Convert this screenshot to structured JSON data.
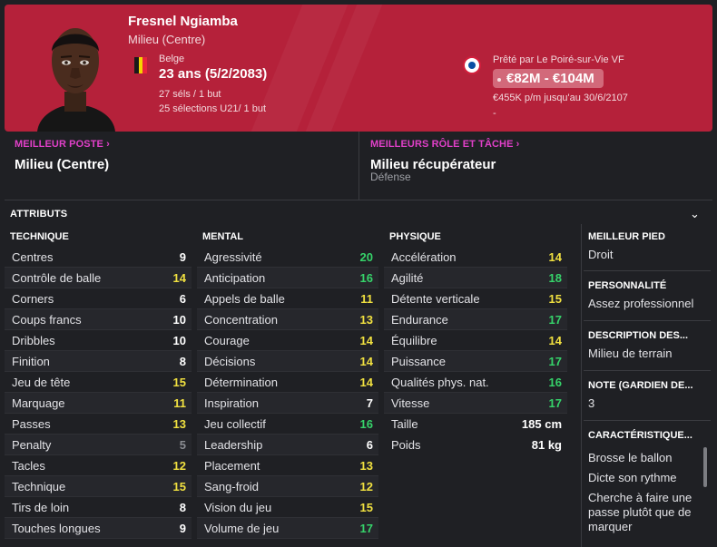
{
  "player": {
    "name": "Fresnel Ngiamba",
    "position": "Milieu (Centre)",
    "nationality": "Belge",
    "age": "23 ans (5/2/2083)",
    "caps": "27 séls / 1 but",
    "u21_caps": "25 sélections U21/ 1 but"
  },
  "contract": {
    "loan_text": "Prêté par Le Poiré-sur-Vie VF",
    "value": "€82M - €104M",
    "wage": "€455K p/m jusqu'au 30/6/2107",
    "extra": "-"
  },
  "colors": {
    "header_bg": "#b5213a",
    "accent_magenta": "#e040c8",
    "good": "#36d36a",
    "ok": "#f0e040"
  },
  "best_position": {
    "label": "MEILLEUR POSTE",
    "value": "Milieu (Centre)"
  },
  "best_role": {
    "label": "MEILLEURS RÔLE ET TÂCHE",
    "value": "Milieu récupérateur",
    "sub": "Défense"
  },
  "attributes": {
    "title": "ATTRIBUTS",
    "technique": {
      "header": "TECHNIQUE",
      "items": [
        {
          "label": "Centres",
          "value": "9"
        },
        {
          "label": "Contrôle de balle",
          "value": "14"
        },
        {
          "label": "Corners",
          "value": "6"
        },
        {
          "label": "Coups francs",
          "value": "10"
        },
        {
          "label": "Dribbles",
          "value": "10"
        },
        {
          "label": "Finition",
          "value": "8"
        },
        {
          "label": "Jeu de tête",
          "value": "15"
        },
        {
          "label": "Marquage",
          "value": "11"
        },
        {
          "label": "Passes",
          "value": "13"
        },
        {
          "label": "Penalty",
          "value": "5"
        },
        {
          "label": "Tacles",
          "value": "12"
        },
        {
          "label": "Technique",
          "value": "15"
        },
        {
          "label": "Tirs de loin",
          "value": "8"
        },
        {
          "label": "Touches longues",
          "value": "9"
        }
      ]
    },
    "mental": {
      "header": "MENTAL",
      "items": [
        {
          "label": "Agressivité",
          "value": "20"
        },
        {
          "label": "Anticipation",
          "value": "16"
        },
        {
          "label": "Appels de balle",
          "value": "11"
        },
        {
          "label": "Concentration",
          "value": "13"
        },
        {
          "label": "Courage",
          "value": "14"
        },
        {
          "label": "Décisions",
          "value": "14"
        },
        {
          "label": "Détermination",
          "value": "14"
        },
        {
          "label": "Inspiration",
          "value": "7"
        },
        {
          "label": "Jeu collectif",
          "value": "16"
        },
        {
          "label": "Leadership",
          "value": "6"
        },
        {
          "label": "Placement",
          "value": "13"
        },
        {
          "label": "Sang-froid",
          "value": "12"
        },
        {
          "label": "Vision du jeu",
          "value": "15"
        },
        {
          "label": "Volume de jeu",
          "value": "17"
        }
      ]
    },
    "physique": {
      "header": "PHYSIQUE",
      "items": [
        {
          "label": "Accélération",
          "value": "14"
        },
        {
          "label": "Agilité",
          "value": "18"
        },
        {
          "label": "Détente verticale",
          "value": "15"
        },
        {
          "label": "Endurance",
          "value": "17"
        },
        {
          "label": "Équilibre",
          "value": "14"
        },
        {
          "label": "Puissance",
          "value": "17"
        },
        {
          "label": "Qualités phys. nat.",
          "value": "16"
        },
        {
          "label": "Vitesse",
          "value": "17"
        }
      ],
      "height_label": "Taille",
      "height_value": "185 cm",
      "weight_label": "Poids",
      "weight_value": "81 kg"
    }
  },
  "side": {
    "foot_label": "MEILLEUR PIED",
    "foot_value": "Droit",
    "personality_label": "PERSONNALITÉ",
    "personality_value": "Assez professionnel",
    "description_label": "DESCRIPTION DES...",
    "description_value": "Milieu de terrain",
    "gk_label": "NOTE (GARDIEN DE...",
    "gk_value": "3",
    "traits_label": "CARACTÉRISTIQUE...",
    "traits": [
      "Brosse le ballon",
      "Dicte son rythme",
      "Cherche à faire une passe plutôt que de marquer"
    ]
  }
}
